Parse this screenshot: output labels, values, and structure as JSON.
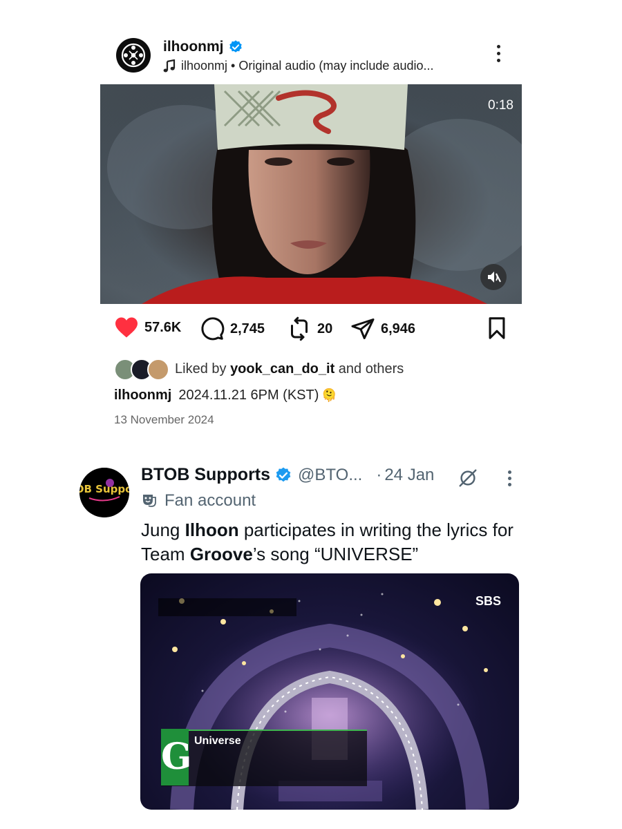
{
  "instagram_post": {
    "username": "ilhoonmj",
    "verified": true,
    "audio_line": "ilhoonmj • Original audio (may include audio...",
    "video": {
      "duration": "0:18",
      "muted": true
    },
    "actions": {
      "likes": "57.6K",
      "comments": "2,745",
      "reposts": "20",
      "shares": "6,946"
    },
    "liked_by": {
      "prefix": "Liked by ",
      "user": "yook_can_do_it",
      "suffix": " and others"
    },
    "caption": {
      "user": "ilhoonmj",
      "text": "2024.11.21 6PM (KST)",
      "emoji": "🫠"
    },
    "date": "13 November 2024"
  },
  "tweet": {
    "display_name": "BTOB Supports",
    "verified": true,
    "handle": "@BTO...",
    "separator": "·",
    "time": "24 Jan",
    "label": "Fan account",
    "avatar_text": "BTOB Supports",
    "text_parts": [
      {
        "t": "Jung ",
        "bold": false
      },
      {
        "t": "Ilhoon",
        "bold": true
      },
      {
        "t": " participates in writing the lyrics for Team ",
        "bold": false
      },
      {
        "t": "Groove",
        "bold": true
      },
      {
        "t": "’s song “UNIVERSE”",
        "bold": false
      }
    ],
    "media": {
      "broadcaster": "SBS",
      "song_title": "Universe",
      "letter": "G"
    }
  },
  "colors": {
    "heart_red": "#ff3040",
    "verified_blue": "#0095f6",
    "twitter_verified": "#1d9bf0",
    "muted_text": "#536471"
  }
}
